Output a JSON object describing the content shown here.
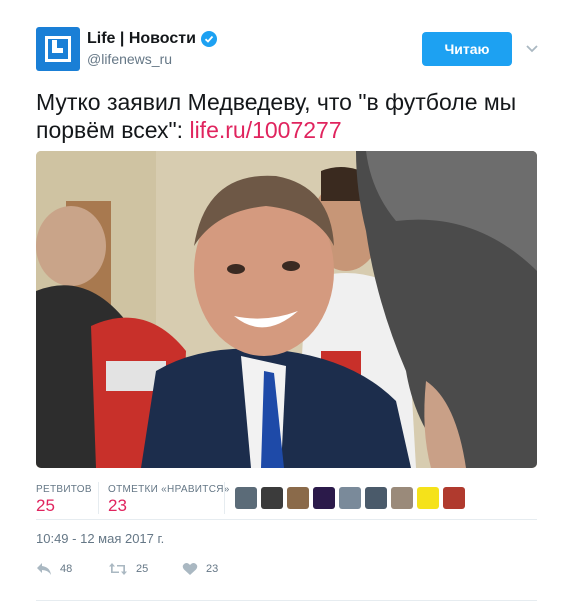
{
  "author": {
    "display_name": "Life | Новости",
    "handle": "@lifenews_ru",
    "verified": true,
    "avatar_icon": "life-logo-icon",
    "brand_color": "#1a7fd6"
  },
  "follow_button": {
    "label": "Читаю",
    "color": "#1da1f2"
  },
  "tweet": {
    "text": "Мутко заявил Медведеву, что \"в футболе мы порвём всех\": ",
    "link": "life.ru/1007277",
    "link_color": "#e0245e"
  },
  "stats": {
    "retweets_label": "РЕТВИТОВ",
    "retweets_value": "25",
    "likes_label": "ОТМЕТКИ «НРАВИТСЯ»",
    "likes_value": "23"
  },
  "likers": [
    {
      "color": "#5b6b78"
    },
    {
      "color": "#3b3b3b"
    },
    {
      "color": "#8a6a4a"
    },
    {
      "color": "#2b1a4a"
    },
    {
      "color": "#7a8a9a"
    },
    {
      "color": "#4a5a6a"
    },
    {
      "color": "#9a8a7a"
    },
    {
      "color": "#f5e21a"
    },
    {
      "color": "#b03a2e"
    }
  ],
  "timestamp": "10:49 - 12 мая 2017 г.",
  "actions": {
    "reply_count": "48",
    "retweet_count": "25",
    "like_count": "23"
  }
}
